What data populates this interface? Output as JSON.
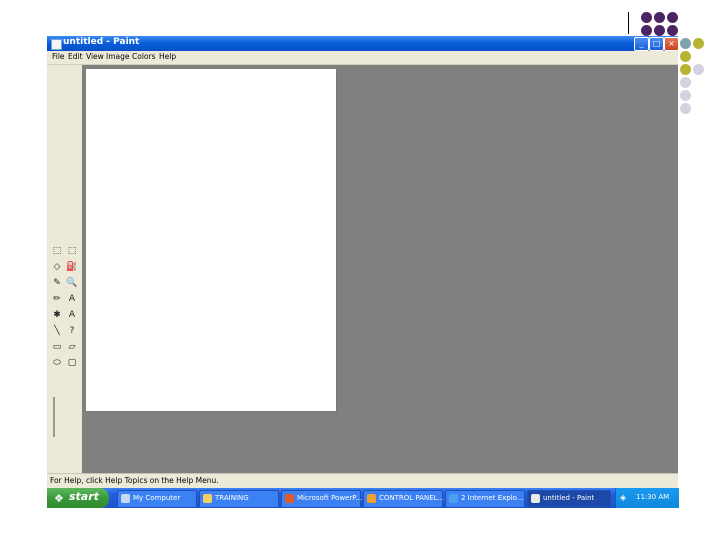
{
  "window": {
    "title": "untitled - Paint",
    "minimize_label": "_",
    "maximize_label": "□",
    "close_label": "×"
  },
  "menubar": {
    "items": [
      {
        "label": "File"
      },
      {
        "label": "Edit"
      },
      {
        "label": "View"
      },
      {
        "label": "Image"
      },
      {
        "label": "Colors"
      },
      {
        "label": "Help"
      }
    ]
  },
  "toolbox": {
    "tools": [
      {
        "name": "free-form-select-icon",
        "glyph": "⬚"
      },
      {
        "name": "select-icon",
        "glyph": "⬚"
      },
      {
        "name": "eraser-icon",
        "glyph": "◇"
      },
      {
        "name": "fill-icon",
        "glyph": "⛽"
      },
      {
        "name": "pick-color-icon",
        "glyph": "✎"
      },
      {
        "name": "magnifier-icon",
        "glyph": "🔍"
      },
      {
        "name": "pencil-icon",
        "glyph": "✏"
      },
      {
        "name": "brush-icon",
        "glyph": "A"
      },
      {
        "name": "airbrush-icon",
        "glyph": "✱"
      },
      {
        "name": "text-icon",
        "glyph": "A"
      },
      {
        "name": "line-icon",
        "glyph": "╲"
      },
      {
        "name": "curve-icon",
        "glyph": "?"
      },
      {
        "name": "rectangle-icon",
        "glyph": "▭"
      },
      {
        "name": "polygon-icon",
        "glyph": "▱"
      },
      {
        "name": "ellipse-icon",
        "glyph": "⬭"
      },
      {
        "name": "rounded-rectangle-icon",
        "glyph": "▢"
      }
    ]
  },
  "statusbar": {
    "text": "For Help, click Help Topics on the Help Menu."
  },
  "taskbar": {
    "start_label": "start",
    "tasks": [
      {
        "label": "My Computer",
        "icon": "computer-icon",
        "color": "#c8d8f0"
      },
      {
        "label": "TRAINING",
        "icon": "folder-icon",
        "color": "#f0d060"
      },
      {
        "label": "Microsoft PowerP...",
        "icon": "powerpoint-icon",
        "color": "#e05a2a"
      },
      {
        "label": "CONTROL PANEL...",
        "icon": "browser-icon",
        "color": "#f0a030"
      },
      {
        "label": "2 Internet Explo...",
        "icon": "ie-icon",
        "color": "#4aa0f0"
      },
      {
        "label": "untitled - Paint",
        "icon": "paint-icon",
        "color": "#e8e8e8"
      }
    ],
    "clock": "11:30 AM"
  },
  "colors": {
    "purple": "#4b2463",
    "teal": "#7fa3a8",
    "olive": "#b8b432",
    "lavender": "#d4d2e0"
  }
}
